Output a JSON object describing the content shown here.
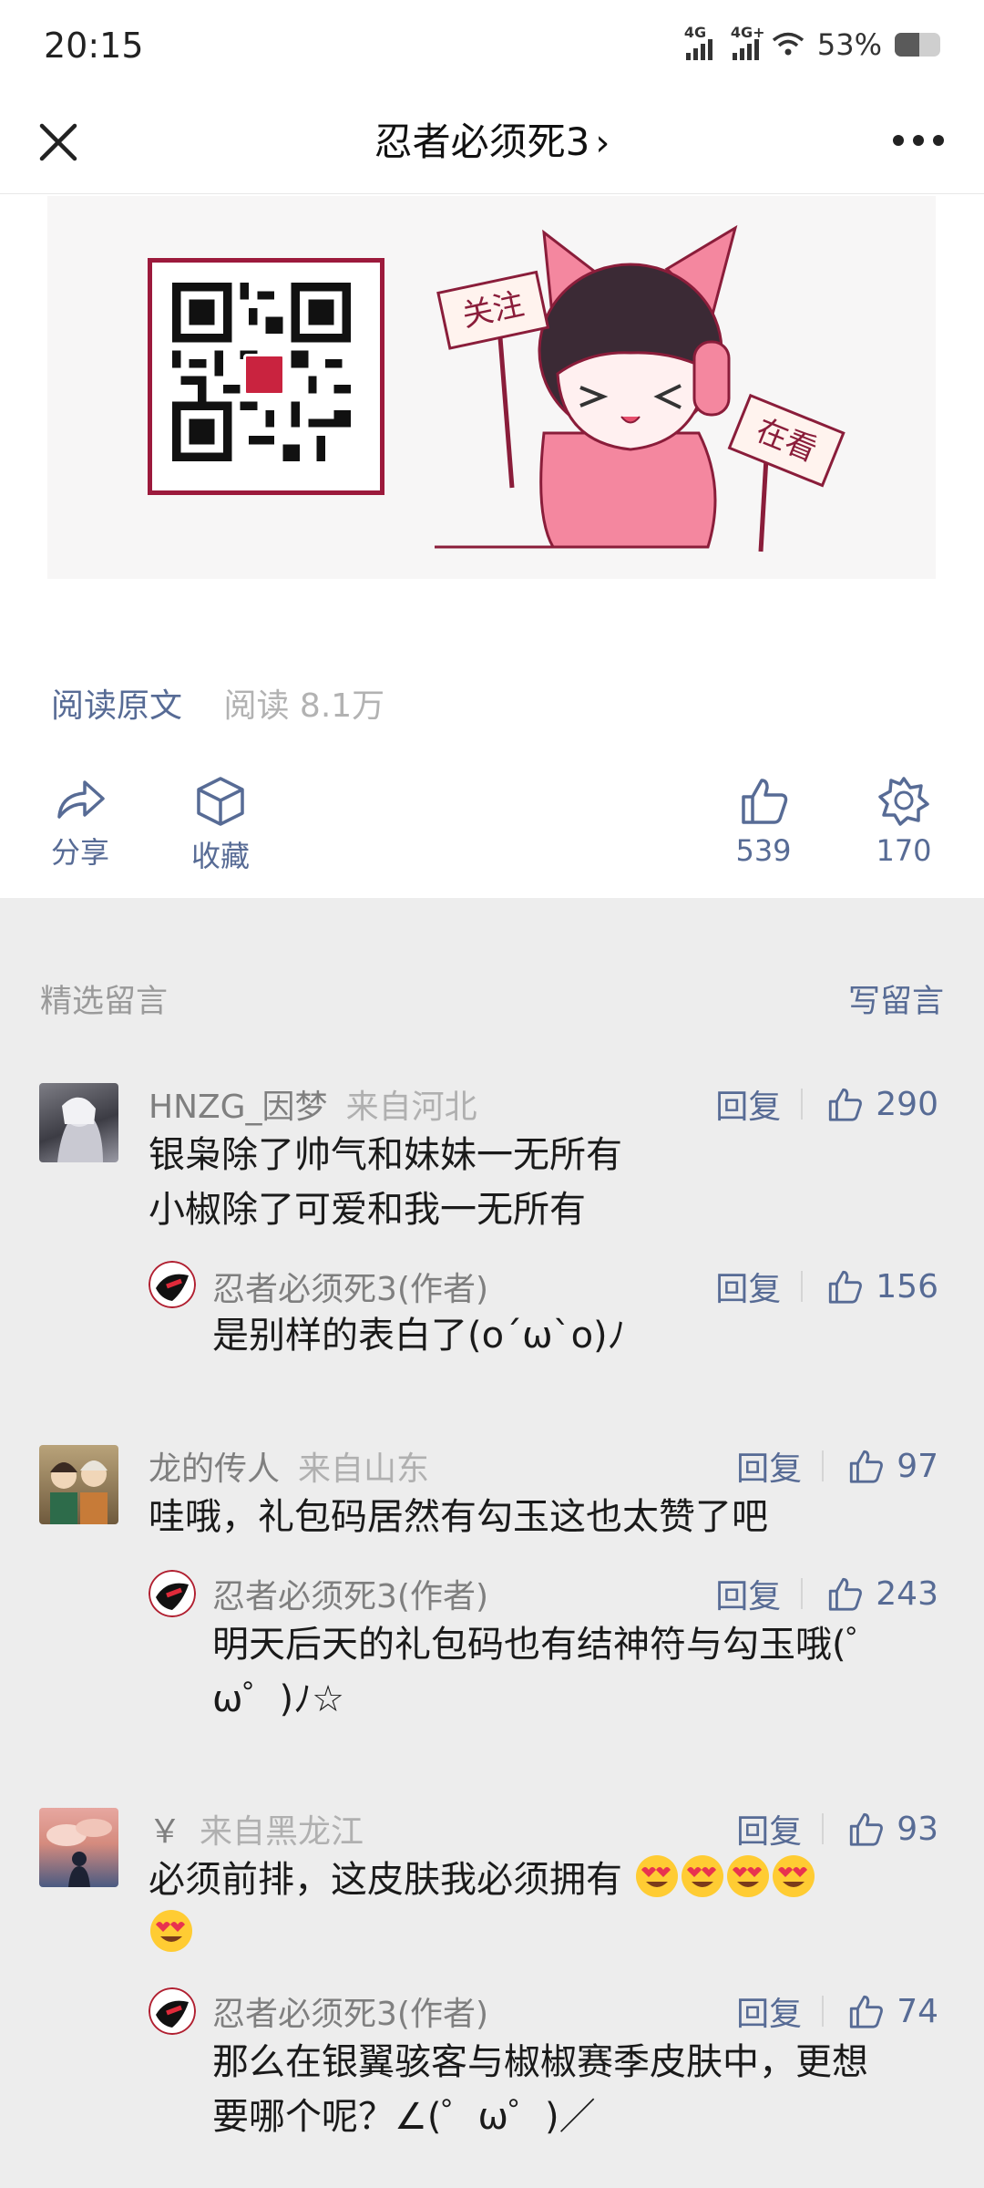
{
  "status_bar": {
    "time": "20:15",
    "network1": "4G",
    "network2": "4G+",
    "battery": "53%",
    "battery_level": 0.53
  },
  "nav": {
    "title": "忍者必须死3",
    "title_chevron": "›"
  },
  "article": {
    "banner_sign_follow": "关注",
    "banner_sign_watching": "在看",
    "read_original": "阅读原文",
    "read_count": "阅读 8.1万"
  },
  "actions": {
    "share_label": "分享",
    "favorite_label": "收藏",
    "like_count": "539",
    "wow_count": "170"
  },
  "comments_section": {
    "heading": "精选留言",
    "write_comment": "写留言"
  },
  "comments": [
    {
      "user": "HNZG_因梦",
      "location": "来自河北",
      "reply_label": "回复",
      "likes": "290",
      "text_line1": "银枭除了帅气和妹妹一无所有",
      "text_line2": "小椒除了可爱和我一无所有",
      "reply": {
        "author": "忍者必须死3(作者)",
        "reply_label": "回复",
        "likes": "156",
        "text": "是别样的表白了(o´ω`o)ﾉ"
      }
    },
    {
      "user": "龙的传人",
      "location": "来自山东",
      "reply_label": "回复",
      "likes": "97",
      "text": "哇哦，礼包码居然有勾玉这也太赞了吧",
      "reply": {
        "author": "忍者必须死3(作者)",
        "reply_label": "回复",
        "likes": "243",
        "text_line1": "明天后天的礼包码也有结神符与勾玉哦(゜",
        "text_line2": "ω゜)ﾉ☆"
      }
    },
    {
      "user": "￥",
      "location": "来自黑龙江",
      "reply_label": "回复",
      "likes": "93",
      "text": "必须前排，这皮肤我必须拥有",
      "reply": {
        "author": "忍者必须死3(作者)",
        "reply_label": "回复",
        "likes": "74",
        "text_line1": "那么在银翼骇客与椒椒赛季皮肤中，更想",
        "text_line2": "要哪个呢？∠(゜ω゜)／"
      }
    }
  ]
}
